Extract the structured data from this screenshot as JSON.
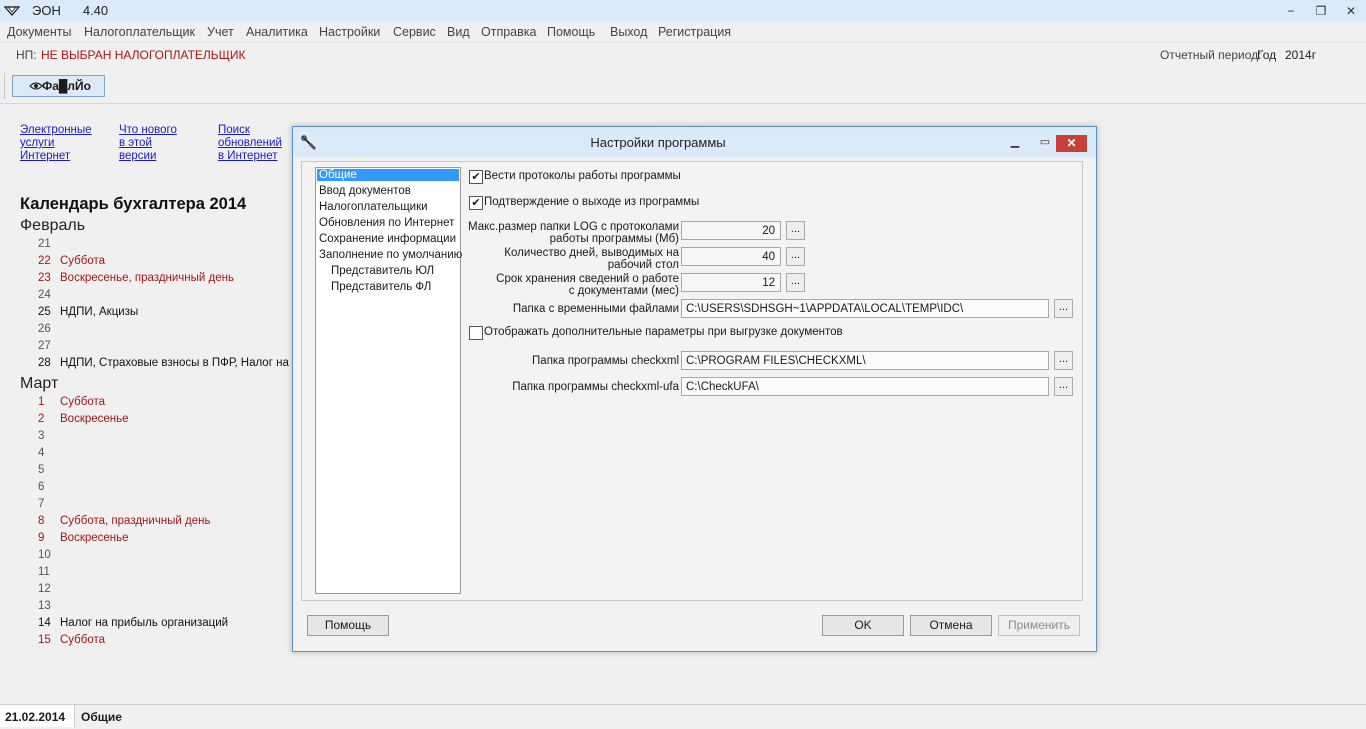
{
  "window": {
    "app_name": "ЭОН",
    "version": "4.40",
    "minimize": "−",
    "restore": "❐",
    "close": "✕"
  },
  "menu": [
    "Документы",
    "Налогоплательщик",
    "Учет",
    "Аналитика",
    "Настройки",
    "Сервис",
    "Вид",
    "Отправка",
    "Помощь",
    "Выход",
    "Регистрация"
  ],
  "np_bar": {
    "label": "НП:",
    "value": "НЕ ВЫБРАН НАЛОГОПЛАТЕЛЬЩИК",
    "period_label": "Отчетный период:",
    "period_type": "Год",
    "period_value": "2014г"
  },
  "toolbar": {
    "button_label": "Фа█лЙо"
  },
  "links": [
    {
      "lines": [
        "Электронные",
        "услуги",
        "Интернет"
      ]
    },
    {
      "lines": [
        "Что нового",
        "в этой",
        "версии"
      ]
    },
    {
      "lines": [
        "Поиск",
        "обновлений",
        "в Интернет"
      ]
    }
  ],
  "calendar": {
    "title": "Календарь бухгалтера 2014",
    "months": [
      {
        "name": "Февраль",
        "days": [
          {
            "n": "21",
            "text": "",
            "style": "gray"
          },
          {
            "n": "22",
            "text": "Суббота",
            "style": "red"
          },
          {
            "n": "23",
            "text": "Воскресенье, праздничный день",
            "style": "red"
          },
          {
            "n": "24",
            "text": "",
            "style": "gray"
          },
          {
            "n": "25",
            "text": "НДПИ, Акцизы",
            "style": "bold"
          },
          {
            "n": "26",
            "text": "",
            "style": "gray"
          },
          {
            "n": "27",
            "text": "",
            "style": "gray"
          },
          {
            "n": "28",
            "text": "НДПИ, Страховые взносы в ПФР, Налог на",
            "style": "bold"
          }
        ]
      },
      {
        "name": "Март",
        "days": [
          {
            "n": "1",
            "text": "Суббота",
            "style": "red"
          },
          {
            "n": "2",
            "text": "Воскресенье",
            "style": "red"
          },
          {
            "n": "3",
            "text": "",
            "style": "gray"
          },
          {
            "n": "4",
            "text": "",
            "style": "gray"
          },
          {
            "n": "5",
            "text": "",
            "style": "gray"
          },
          {
            "n": "6",
            "text": "",
            "style": "gray"
          },
          {
            "n": "7",
            "text": "",
            "style": "gray"
          },
          {
            "n": "8",
            "text": "Суббота, праздничный день",
            "style": "red"
          },
          {
            "n": "9",
            "text": "Воскресенье",
            "style": "red"
          },
          {
            "n": "10",
            "text": "",
            "style": "gray"
          },
          {
            "n": "11",
            "text": "",
            "style": "gray"
          },
          {
            "n": "12",
            "text": "",
            "style": "gray"
          },
          {
            "n": "13",
            "text": "",
            "style": "gray"
          },
          {
            "n": "14",
            "text": "Налог на прибыль организаций",
            "style": "bold"
          },
          {
            "n": "15",
            "text": "Суббота",
            "style": "red"
          }
        ]
      }
    ]
  },
  "statusbar": {
    "date": "21.02.2014",
    "section": "Общие"
  },
  "dialog": {
    "title": "Настройки программы",
    "nav": [
      {
        "label": "Общие",
        "selected": true,
        "indent": false
      },
      {
        "label": "Ввод документов",
        "selected": false,
        "indent": false
      },
      {
        "label": "Налогоплательщики",
        "selected": false,
        "indent": false
      },
      {
        "label": "Обновления по Интернет",
        "selected": false,
        "indent": false
      },
      {
        "label": "Сохранение информации",
        "selected": false,
        "indent": false
      },
      {
        "label": "Заполнение по умолчанию",
        "selected": false,
        "indent": false
      },
      {
        "label": "Представитель ЮЛ",
        "selected": false,
        "indent": true
      },
      {
        "label": "Представитель ФЛ",
        "selected": false,
        "indent": true
      }
    ],
    "cb_log": {
      "label": "Вести протоколы работы программы",
      "checked": "✔"
    },
    "cb_exit": {
      "label": "Подтверждение о выходе из программы",
      "checked": "✔"
    },
    "log_size": {
      "label1": "Макс.размер папки LOG с протоколами",
      "label2": "работы программы (Мб)",
      "value": "20"
    },
    "days": {
      "label1": "Количество дней, выводимых на",
      "label2": "рабочий стол",
      "value": "40"
    },
    "retention": {
      "label1": "Срок хранения сведений о работе",
      "label2": "с документами (мес)",
      "value": "12"
    },
    "temp_folder": {
      "label": "Папка с временными файлами",
      "value": "C:\\USERS\\SDHSGH~1\\APPDATA\\LOCAL\\TEMP\\IDC\\"
    },
    "cb_extra": {
      "label": "Отображать дополнительные параметры при выгрузке документов",
      "checked": ""
    },
    "checkxml": {
      "label": "Папка программы checkxml",
      "value": "C:\\PROGRAM FILES\\CHECKXML\\"
    },
    "checkxml_ufa": {
      "label": "Папка программы checkxml-ufa",
      "value": "C:\\CheckUFA\\"
    },
    "dots": "...",
    "buttons": {
      "help": "Помощь",
      "ok": "OK",
      "cancel": "Отмена",
      "apply": "Применить"
    }
  }
}
